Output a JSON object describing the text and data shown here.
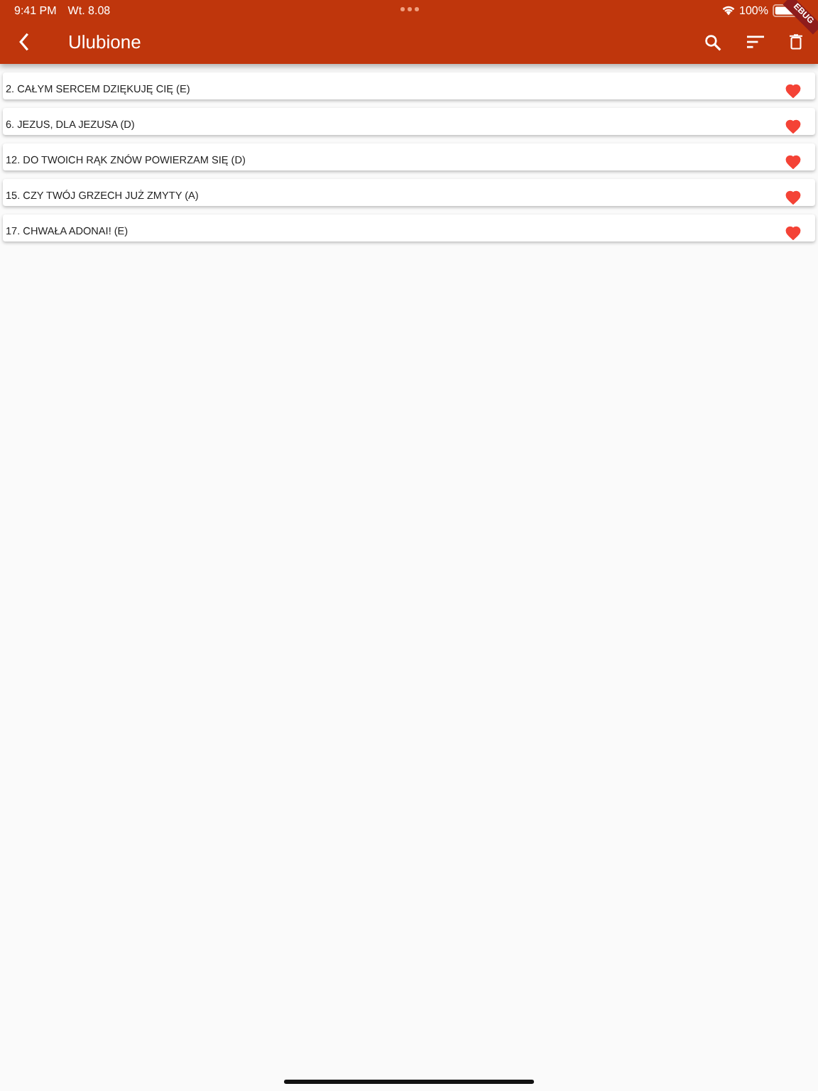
{
  "status_bar": {
    "time": "9:41 PM",
    "date": "Wt. 8.08",
    "battery": "100%"
  },
  "app_bar": {
    "title": "Ulubione"
  },
  "debug_banner": "EBUG",
  "items": [
    {
      "title": "2. CAŁYM SERCEM DZIĘKUJĘ CIĘ (E)",
      "favorite": true
    },
    {
      "title": "6. JEZUS, DLA JEZUSA (D)",
      "favorite": true
    },
    {
      "title": "12. DO TWOICH RĄK ZNÓW POWIERZAM SIĘ (D)",
      "favorite": true
    },
    {
      "title": "15. CZY TWÓJ GRZECH JUŻ ZMYTY (A)",
      "favorite": true
    },
    {
      "title": "17. CHWAŁA ADONAI! (E)",
      "favorite": true
    }
  ]
}
